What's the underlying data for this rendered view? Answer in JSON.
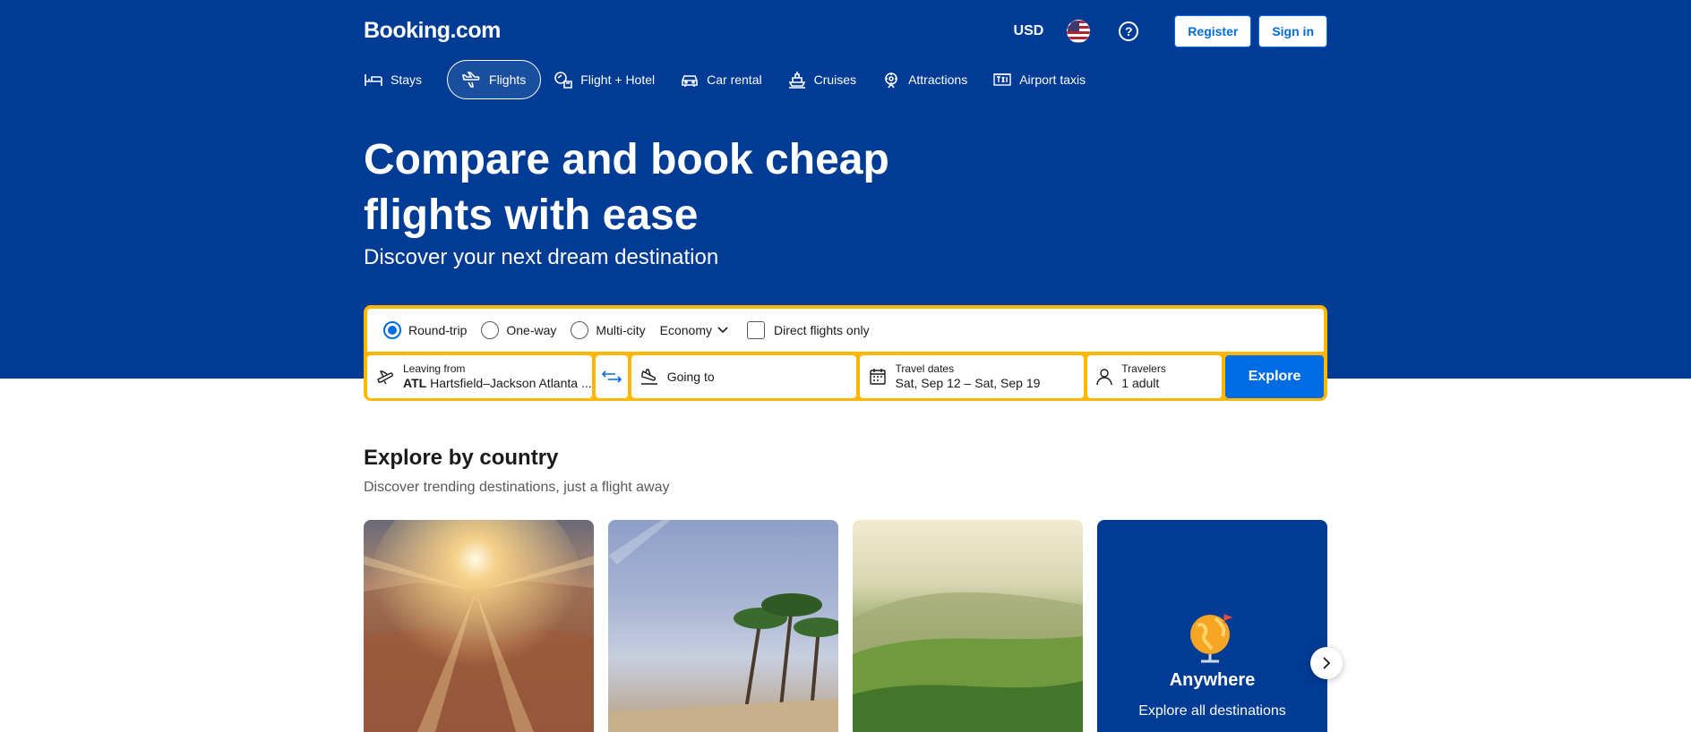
{
  "header": {
    "logo": "Booking.com",
    "currency": "USD",
    "register_label": "Register",
    "signin_label": "Sign in"
  },
  "nav": {
    "items": [
      {
        "label": "Stays",
        "icon": "bed-icon"
      },
      {
        "label": "Flights",
        "icon": "plane-icon",
        "active": true
      },
      {
        "label": "Flight + Hotel",
        "icon": "flight-hotel-icon"
      },
      {
        "label": "Car rental",
        "icon": "car-icon"
      },
      {
        "label": "Cruises",
        "icon": "ship-icon"
      },
      {
        "label": "Attractions",
        "icon": "attractions-icon"
      },
      {
        "label": "Airport taxis",
        "icon": "taxi-icon"
      }
    ]
  },
  "hero": {
    "title_line1": "Compare and book cheap",
    "title_line2": "flights with ease",
    "subtitle": "Discover your next dream destination"
  },
  "search": {
    "trip_types": [
      "Round-trip",
      "One-way",
      "Multi-city"
    ],
    "selected_trip_type": "Round-trip",
    "cabin_class": "Economy",
    "direct_only_label": "Direct flights only",
    "leaving_label": "Leaving from",
    "leaving_code": "ATL",
    "leaving_value": "Hartsfield–Jackson Atlanta ...",
    "going_placeholder": "Going to",
    "dates_label": "Travel dates",
    "dates_value": "Sat, Sep 12 – Sat, Sep 19",
    "travelers_label": "Travelers",
    "travelers_value": "1 adult",
    "explore_label": "Explore"
  },
  "explore": {
    "title": "Explore by country",
    "subtitle": "Discover trending destinations, just a flight away",
    "anywhere_title": "Anywhere",
    "anywhere_desc": "Explore all destinations"
  },
  "colors": {
    "brand_blue": "#003b95",
    "accent_blue": "#006ce4",
    "search_border": "#ffb700"
  }
}
